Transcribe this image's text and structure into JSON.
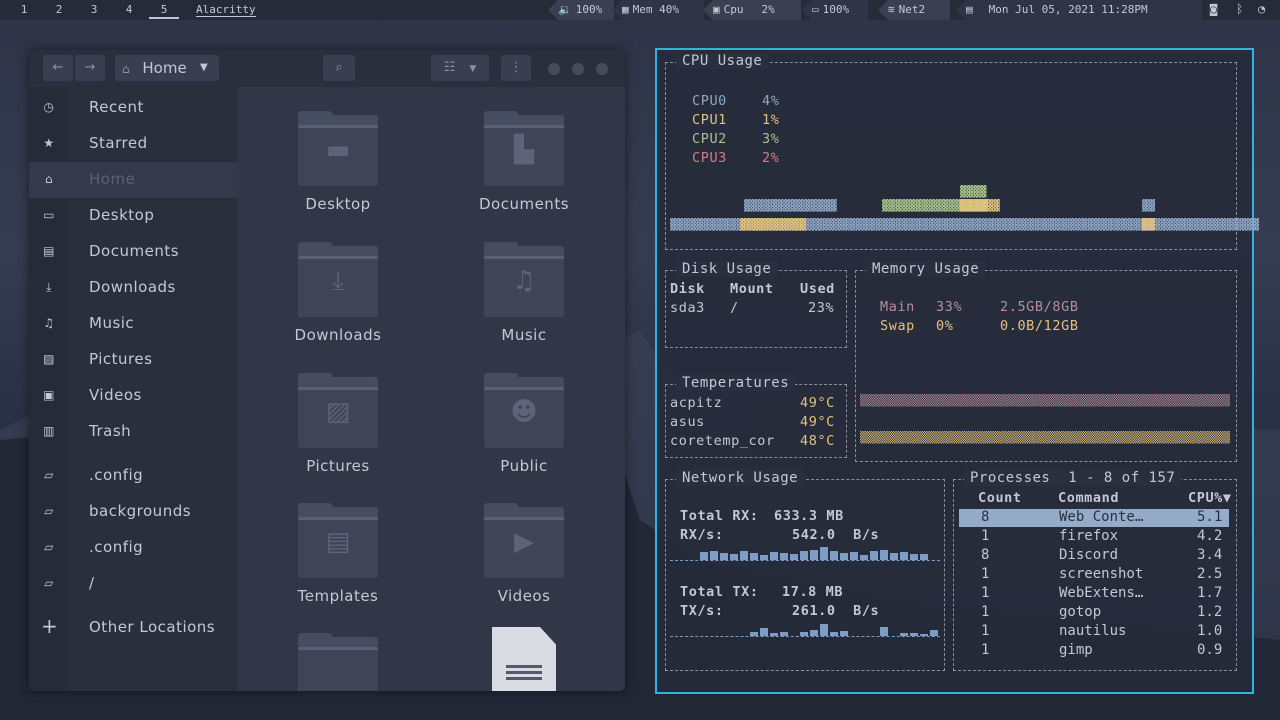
{
  "topbar": {
    "workspaces": [
      "1",
      "2",
      "3",
      "4",
      "5"
    ],
    "active_workspace": "5",
    "window_title": "Alacritty",
    "volume": "100%",
    "memory": "Mem 40%",
    "cpu_label": "Cpu",
    "cpu_value": "2%",
    "battery": "100%",
    "network": "Net2",
    "datetime": "Mon Jul 05, 2021 11:28PM"
  },
  "filemanager": {
    "location": "Home",
    "sidebar": [
      {
        "label": "Recent",
        "icon": "clock-icon"
      },
      {
        "label": "Starred",
        "icon": "star-icon"
      },
      {
        "label": "Home",
        "icon": "home-icon"
      },
      {
        "label": "Desktop",
        "icon": "desktop-icon"
      },
      {
        "label": "Documents",
        "icon": "documents-icon"
      },
      {
        "label": "Downloads",
        "icon": "download-icon"
      },
      {
        "label": "Music",
        "icon": "music-icon"
      },
      {
        "label": "Pictures",
        "icon": "pictures-icon"
      },
      {
        "label": "Videos",
        "icon": "videos-icon"
      },
      {
        "label": "Trash",
        "icon": "trash-icon"
      },
      {
        "label": ".config",
        "icon": "folder-icon"
      },
      {
        "label": "backgrounds",
        "icon": "folder-icon"
      },
      {
        "label": ".config",
        "icon": "folder-icon"
      },
      {
        "label": "/",
        "icon": "folder-icon"
      },
      {
        "label": "Other Locations",
        "icon": "plus-icon"
      }
    ],
    "selected_sidebar": "Home",
    "folders": [
      "Desktop",
      "Documents",
      "Downloads",
      "Music",
      "Pictures",
      "Public",
      "Templates",
      "Videos"
    ]
  },
  "btop": {
    "cpu": {
      "title": "CPU Usage",
      "cores": [
        {
          "name": "CPU0",
          "value": "4%",
          "color": "#8fa6c4"
        },
        {
          "name": "CPU1",
          "value": "1%",
          "color": "#e3c27a"
        },
        {
          "name": "CPU2",
          "value": "3%",
          "color": "#a9c28a"
        },
        {
          "name": "CPU3",
          "value": "2%",
          "color": "#d67a82"
        }
      ]
    },
    "disk": {
      "title": "Disk Usage",
      "headers": [
        "Disk",
        "Mount",
        "Used"
      ],
      "rows": [
        [
          "sda3",
          "/",
          "23%"
        ]
      ]
    },
    "memory": {
      "title": "Memory Usage",
      "rows": [
        {
          "name": "Main",
          "pct": "33%",
          "amount": "2.5GB/8GB",
          "color": "#b48e9c"
        },
        {
          "name": "Swap",
          "pct": "0%",
          "amount": "0.0B/12GB",
          "color": "#e3c27a"
        }
      ]
    },
    "temps": {
      "title": "Temperatures",
      "rows": [
        [
          "acpitz",
          "49°C"
        ],
        [
          "asus",
          "49°C"
        ],
        [
          "coretemp_cor",
          "48°C"
        ]
      ]
    },
    "network": {
      "title": "Network Usage",
      "total_rx_label": "Total RX:",
      "total_rx": "633.3 MB",
      "rx_label": "RX/s:",
      "rx": "542.0  B/s",
      "total_tx_label": "Total TX:",
      "total_tx": "17.8 MB",
      "tx_label": "TX/s:",
      "tx": "261.0  B/s"
    },
    "processes": {
      "title": "Processes",
      "range": "1 - 8 of 157",
      "headers": [
        "Count",
        "Command",
        "CPU%▼"
      ],
      "rows": [
        [
          "8",
          "Web Conte…",
          "5.1"
        ],
        [
          "1",
          "firefox",
          "4.2"
        ],
        [
          "8",
          "Discord",
          "3.4"
        ],
        [
          "1",
          "screenshot",
          "2.5"
        ],
        [
          "1",
          "WebExtens…",
          "1.7"
        ],
        [
          "1",
          "gotop",
          "1.2"
        ],
        [
          "1",
          "nautilus",
          "1.0"
        ],
        [
          "1",
          "gimp",
          "0.9"
        ]
      ]
    }
  }
}
